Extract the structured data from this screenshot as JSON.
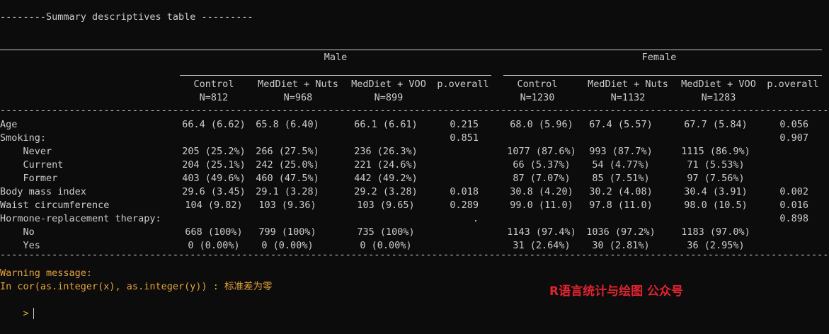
{
  "title": "--------Summary descriptives table ---------",
  "groups": [
    "Male",
    "Female"
  ],
  "column_headers": {
    "male": [
      {
        "name": "Control",
        "n": "N=812"
      },
      {
        "name": "MedDiet + Nuts",
        "n": "N=968"
      },
      {
        "name": "MedDiet + VOO",
        "n": "N=899"
      },
      {
        "name": "p.overall",
        "n": ""
      }
    ],
    "female": [
      {
        "name": "Control",
        "n": "N=1230"
      },
      {
        "name": "MedDiet + Nuts",
        "n": "N=1132"
      },
      {
        "name": "MedDiet + VOO",
        "n": "N=1283"
      },
      {
        "name": "p.overall",
        "n": ""
      }
    ]
  },
  "dashes": "-----------------------------------------------------------------------------------------------------------------------------------------------------------------------",
  "rows": [
    {
      "label": "Age",
      "cells": [
        "66.4 (6.62)",
        "65.8 (6.40)",
        "66.1 (6.61)",
        "0.215",
        "68.0 (5.96)",
        "67.4 (5.57)",
        "67.7 (5.84)",
        "0.056"
      ]
    },
    {
      "label": "Smoking:",
      "cells": [
        "",
        "",
        "",
        "0.851",
        "",
        "",
        "",
        "0.907"
      ]
    },
    {
      "label": "    Never",
      "cells": [
        "205 (25.2%)",
        "266 (27.5%)",
        "236 (26.3%)",
        "",
        "1077 (87.6%)",
        "993 (87.7%)",
        "1115 (86.9%)",
        ""
      ]
    },
    {
      "label": "    Current",
      "cells": [
        "204 (25.1%)",
        "242 (25.0%)",
        "221 (24.6%)",
        "",
        "66 (5.37%)",
        "54 (4.77%)",
        "71 (5.53%)",
        ""
      ]
    },
    {
      "label": "    Former",
      "cells": [
        "403 (49.6%)",
        "460 (47.5%)",
        "442 (49.2%)",
        "",
        "87 (7.07%)",
        "85 (7.51%)",
        "97 (7.56%)",
        ""
      ]
    },
    {
      "label": "Body mass index",
      "cells": [
        "29.6 (3.45)",
        "29.1 (3.28)",
        "29.2 (3.28)",
        "0.018",
        "30.8 (4.20)",
        "30.2 (4.08)",
        "30.4 (3.91)",
        "0.002"
      ]
    },
    {
      "label": "Waist circumference",
      "cells": [
        "104 (9.82)",
        "103 (9.36)",
        "103 (9.65)",
        "0.289",
        "99.0 (11.0)",
        "97.8 (11.0)",
        "98.0 (10.5)",
        "0.016"
      ]
    },
    {
      "label": "Hormone-replacement therapy:",
      "cells": [
        "",
        "",
        "",
        ".",
        "",
        "",
        "",
        "0.898"
      ]
    },
    {
      "label": "    No",
      "cells": [
        "668 (100%)",
        "799 (100%)",
        "735 (100%)",
        "",
        "1143 (97.4%)",
        "1036 (97.2%)",
        "1183 (97.0%)",
        ""
      ]
    },
    {
      "label": "    Yes",
      "cells": [
        "0 (0.00%)",
        "0 (0.00%)",
        "0 (0.00%)",
        "",
        "31 (2.64%)",
        "30 (2.81%)",
        "36 (2.95%)",
        ""
      ]
    }
  ],
  "warning": {
    "line1": "Warning message:",
    "line2": "In cor(as.integer(x), as.integer(y)) : 标准差为零"
  },
  "watermark": "R语言统计与绘图 公众号",
  "prompt": ">",
  "colors": {
    "background": "#0c0c0c",
    "text": "#cccccc",
    "warning": "#e5a33a",
    "watermark": "#e0242f"
  }
}
